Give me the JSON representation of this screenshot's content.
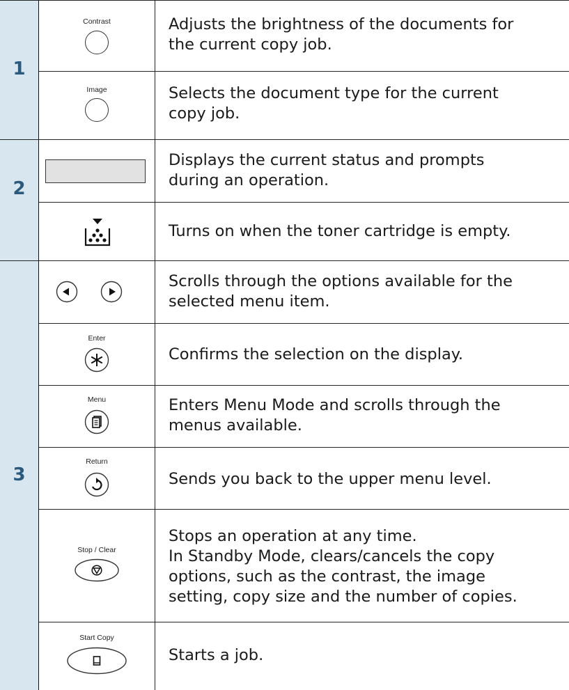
{
  "sections": [
    {
      "number": "1"
    },
    {
      "number": "2"
    },
    {
      "number": "3"
    }
  ],
  "rows": [
    {
      "label": "Contrast",
      "icon": "contrast-button-icon",
      "lines": [
        "Adjusts the brightness of the documents for",
        "the current copy job."
      ]
    },
    {
      "label": "Image",
      "icon": "image-button-icon",
      "lines": [
        "Selects the document type for the current",
        "copy job."
      ]
    },
    {
      "label": "",
      "icon": "lcd-display-icon",
      "lines": [
        "Displays the current status and prompts",
        "during an operation."
      ]
    },
    {
      "label": "",
      "icon": "toner-empty-icon",
      "lines": [
        "Turns on when the toner cartridge is empty."
      ]
    },
    {
      "label": "",
      "icon": "scroll-arrows-icon",
      "lines": [
        "Scrolls through the options available for the",
        "selected menu item."
      ]
    },
    {
      "label": "Enter",
      "icon": "enter-button-icon",
      "lines": [
        "Confirms the selection on the display."
      ]
    },
    {
      "label": "Menu",
      "icon": "menu-button-icon",
      "lines": [
        "Enters Menu Mode and scrolls through the",
        "menus available."
      ]
    },
    {
      "label": "Return",
      "icon": "return-button-icon",
      "lines": [
        "Sends you back to the upper menu level."
      ]
    },
    {
      "label": "Stop / Clear",
      "icon": "stop-clear-button-icon",
      "lines": [
        "Stops an operation at any time.",
        "In Standby Mode, clears/cancels the copy",
        "options, such as the contrast, the image",
        "setting, copy size and the number of copies."
      ]
    },
    {
      "label": "Start Copy",
      "icon": "start-copy-button-icon",
      "lines": [
        "Starts a job."
      ]
    }
  ],
  "colors": {
    "section_band": "#d8e6f0",
    "section_number": "#2c5a7c",
    "lcd_fill": "#e2e2e2"
  }
}
